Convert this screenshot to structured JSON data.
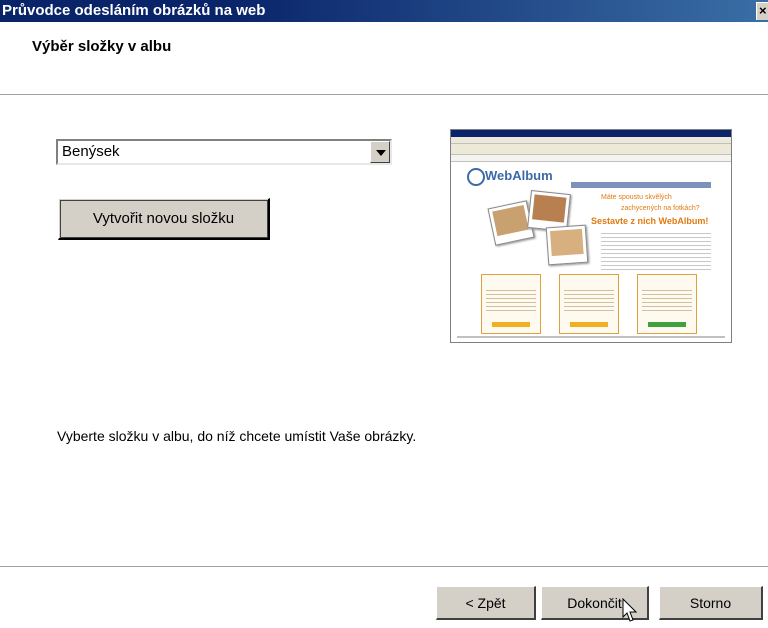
{
  "window": {
    "title": "Průvodce odesláním obrázků na web",
    "close_label": "×"
  },
  "header": {
    "title": "Výběr složky v albu"
  },
  "folder_select": {
    "value": "Benýsek"
  },
  "create_folder_button": {
    "label": "Vytvořit novou složku"
  },
  "instruction": "Vyberte složku v albu, do níž chcete umístit Vaše obrázky.",
  "preview": {
    "logo": "WebAlbum",
    "headline1": "Máte spoustu skvělých",
    "headline2": "zachycených na fotkách?",
    "headline3": "Sestavte z nich WebAlbum!"
  },
  "footer_buttons": {
    "back": "< Zpět",
    "finish": "Dokončit",
    "cancel": "Storno"
  },
  "colors": {
    "titlebar": "#0a246a",
    "face": "#d4d0c8",
    "accent_orange": "#e07a10"
  }
}
